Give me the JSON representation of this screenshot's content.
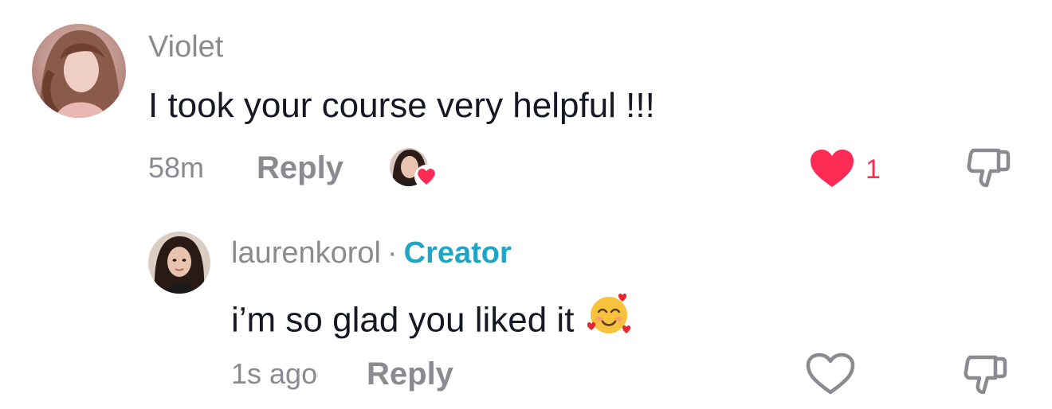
{
  "comment": {
    "username": "Violet",
    "text": "I took your course very helpful !!!",
    "time": "58m",
    "reply_label": "Reply",
    "like_count": "1",
    "liked": true,
    "liked_by_creator": true
  },
  "reply": {
    "username": "laurenkorol",
    "separator": "·",
    "badge": "Creator",
    "text": "i’m so glad you liked it",
    "emoji": "smiling-face-with-hearts",
    "time": "1s ago",
    "reply_label": "Reply",
    "liked": false
  },
  "colors": {
    "like_red": "#fe2c55",
    "creator_blue": "#20a6c4",
    "muted_gray": "#8a8b91",
    "text_dark": "#161823"
  },
  "icons": {
    "like": "heart-icon",
    "dislike": "thumbs-down-icon"
  }
}
